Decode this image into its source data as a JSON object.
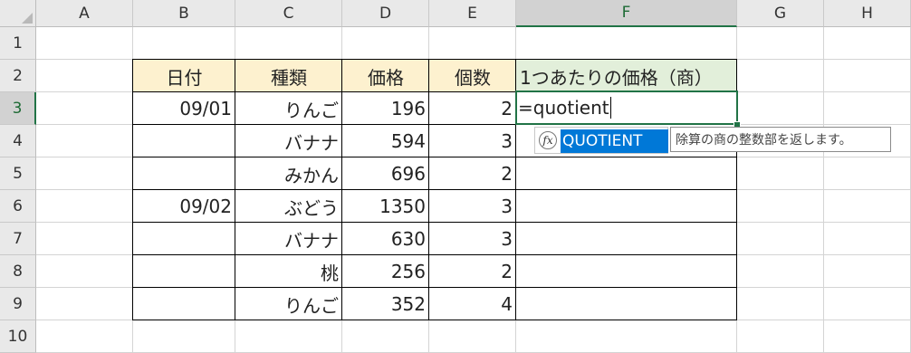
{
  "columns": [
    "A",
    "B",
    "C",
    "D",
    "E",
    "F",
    "G",
    "H"
  ],
  "rows": [
    "1",
    "2",
    "3",
    "4",
    "5",
    "6",
    "7",
    "8",
    "9",
    "10"
  ],
  "active_column": "F",
  "active_row": "3",
  "table": {
    "headers": [
      "日付",
      "種類",
      "価格",
      "個数",
      "1つあたりの価格（商）"
    ],
    "rows": [
      [
        "09/01",
        "りんご",
        "196",
        "2"
      ],
      [
        "",
        "バナナ",
        "594",
        "3"
      ],
      [
        "",
        "みかん",
        "696",
        "2"
      ],
      [
        "09/02",
        "ぶどう",
        "1350",
        "3"
      ],
      [
        "",
        "バナナ",
        "630",
        "3"
      ],
      [
        "",
        "桃",
        "256",
        "2"
      ],
      [
        "",
        "りんご",
        "352",
        "4"
      ]
    ]
  },
  "editing_cell": {
    "ref": "F3",
    "text": "=quotient"
  },
  "autocomplete": {
    "icon": "function-fx-icon",
    "icon_text": "fx",
    "item": "QUOTIENT",
    "tooltip": "除算の商の整数部を返します。"
  },
  "colors": {
    "header_fill": "#fdf1cf",
    "result_header_fill": "#e2efda",
    "accent": "#217346",
    "selection": "#0078d7"
  }
}
